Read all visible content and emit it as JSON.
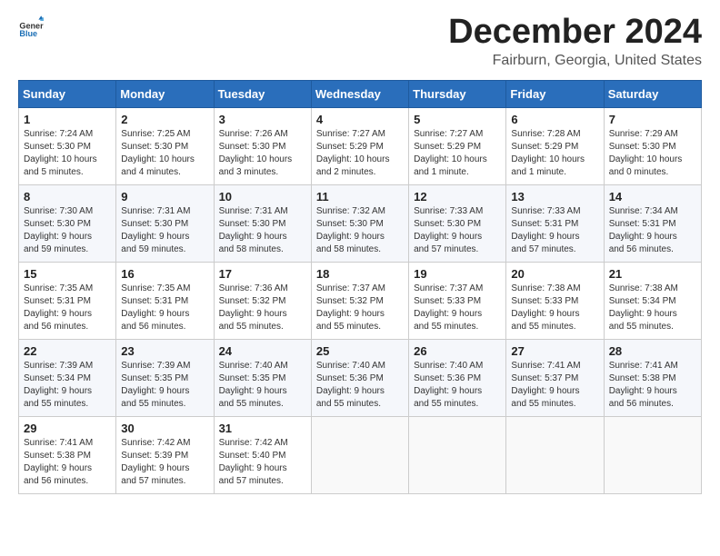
{
  "logo": {
    "text_general": "General",
    "text_blue": "Blue"
  },
  "header": {
    "month": "December 2024",
    "location": "Fairburn, Georgia, United States"
  },
  "weekdays": [
    "Sunday",
    "Monday",
    "Tuesday",
    "Wednesday",
    "Thursday",
    "Friday",
    "Saturday"
  ],
  "weeks": [
    [
      {
        "day": "1",
        "info": "Sunrise: 7:24 AM\nSunset: 5:30 PM\nDaylight: 10 hours\nand 5 minutes."
      },
      {
        "day": "2",
        "info": "Sunrise: 7:25 AM\nSunset: 5:30 PM\nDaylight: 10 hours\nand 4 minutes."
      },
      {
        "day": "3",
        "info": "Sunrise: 7:26 AM\nSunset: 5:30 PM\nDaylight: 10 hours\nand 3 minutes."
      },
      {
        "day": "4",
        "info": "Sunrise: 7:27 AM\nSunset: 5:29 PM\nDaylight: 10 hours\nand 2 minutes."
      },
      {
        "day": "5",
        "info": "Sunrise: 7:27 AM\nSunset: 5:29 PM\nDaylight: 10 hours\nand 1 minute."
      },
      {
        "day": "6",
        "info": "Sunrise: 7:28 AM\nSunset: 5:29 PM\nDaylight: 10 hours\nand 1 minute."
      },
      {
        "day": "7",
        "info": "Sunrise: 7:29 AM\nSunset: 5:30 PM\nDaylight: 10 hours\nand 0 minutes."
      }
    ],
    [
      {
        "day": "8",
        "info": "Sunrise: 7:30 AM\nSunset: 5:30 PM\nDaylight: 9 hours\nand 59 minutes."
      },
      {
        "day": "9",
        "info": "Sunrise: 7:31 AM\nSunset: 5:30 PM\nDaylight: 9 hours\nand 59 minutes."
      },
      {
        "day": "10",
        "info": "Sunrise: 7:31 AM\nSunset: 5:30 PM\nDaylight: 9 hours\nand 58 minutes."
      },
      {
        "day": "11",
        "info": "Sunrise: 7:32 AM\nSunset: 5:30 PM\nDaylight: 9 hours\nand 58 minutes."
      },
      {
        "day": "12",
        "info": "Sunrise: 7:33 AM\nSunset: 5:30 PM\nDaylight: 9 hours\nand 57 minutes."
      },
      {
        "day": "13",
        "info": "Sunrise: 7:33 AM\nSunset: 5:31 PM\nDaylight: 9 hours\nand 57 minutes."
      },
      {
        "day": "14",
        "info": "Sunrise: 7:34 AM\nSunset: 5:31 PM\nDaylight: 9 hours\nand 56 minutes."
      }
    ],
    [
      {
        "day": "15",
        "info": "Sunrise: 7:35 AM\nSunset: 5:31 PM\nDaylight: 9 hours\nand 56 minutes."
      },
      {
        "day": "16",
        "info": "Sunrise: 7:35 AM\nSunset: 5:31 PM\nDaylight: 9 hours\nand 56 minutes."
      },
      {
        "day": "17",
        "info": "Sunrise: 7:36 AM\nSunset: 5:32 PM\nDaylight: 9 hours\nand 55 minutes."
      },
      {
        "day": "18",
        "info": "Sunrise: 7:37 AM\nSunset: 5:32 PM\nDaylight: 9 hours\nand 55 minutes."
      },
      {
        "day": "19",
        "info": "Sunrise: 7:37 AM\nSunset: 5:33 PM\nDaylight: 9 hours\nand 55 minutes."
      },
      {
        "day": "20",
        "info": "Sunrise: 7:38 AM\nSunset: 5:33 PM\nDaylight: 9 hours\nand 55 minutes."
      },
      {
        "day": "21",
        "info": "Sunrise: 7:38 AM\nSunset: 5:34 PM\nDaylight: 9 hours\nand 55 minutes."
      }
    ],
    [
      {
        "day": "22",
        "info": "Sunrise: 7:39 AM\nSunset: 5:34 PM\nDaylight: 9 hours\nand 55 minutes."
      },
      {
        "day": "23",
        "info": "Sunrise: 7:39 AM\nSunset: 5:35 PM\nDaylight: 9 hours\nand 55 minutes."
      },
      {
        "day": "24",
        "info": "Sunrise: 7:40 AM\nSunset: 5:35 PM\nDaylight: 9 hours\nand 55 minutes."
      },
      {
        "day": "25",
        "info": "Sunrise: 7:40 AM\nSunset: 5:36 PM\nDaylight: 9 hours\nand 55 minutes."
      },
      {
        "day": "26",
        "info": "Sunrise: 7:40 AM\nSunset: 5:36 PM\nDaylight: 9 hours\nand 55 minutes."
      },
      {
        "day": "27",
        "info": "Sunrise: 7:41 AM\nSunset: 5:37 PM\nDaylight: 9 hours\nand 55 minutes."
      },
      {
        "day": "28",
        "info": "Sunrise: 7:41 AM\nSunset: 5:38 PM\nDaylight: 9 hours\nand 56 minutes."
      }
    ],
    [
      {
        "day": "29",
        "info": "Sunrise: 7:41 AM\nSunset: 5:38 PM\nDaylight: 9 hours\nand 56 minutes."
      },
      {
        "day": "30",
        "info": "Sunrise: 7:42 AM\nSunset: 5:39 PM\nDaylight: 9 hours\nand 57 minutes."
      },
      {
        "day": "31",
        "info": "Sunrise: 7:42 AM\nSunset: 5:40 PM\nDaylight: 9 hours\nand 57 minutes."
      },
      {
        "day": "",
        "info": ""
      },
      {
        "day": "",
        "info": ""
      },
      {
        "day": "",
        "info": ""
      },
      {
        "day": "",
        "info": ""
      }
    ]
  ]
}
